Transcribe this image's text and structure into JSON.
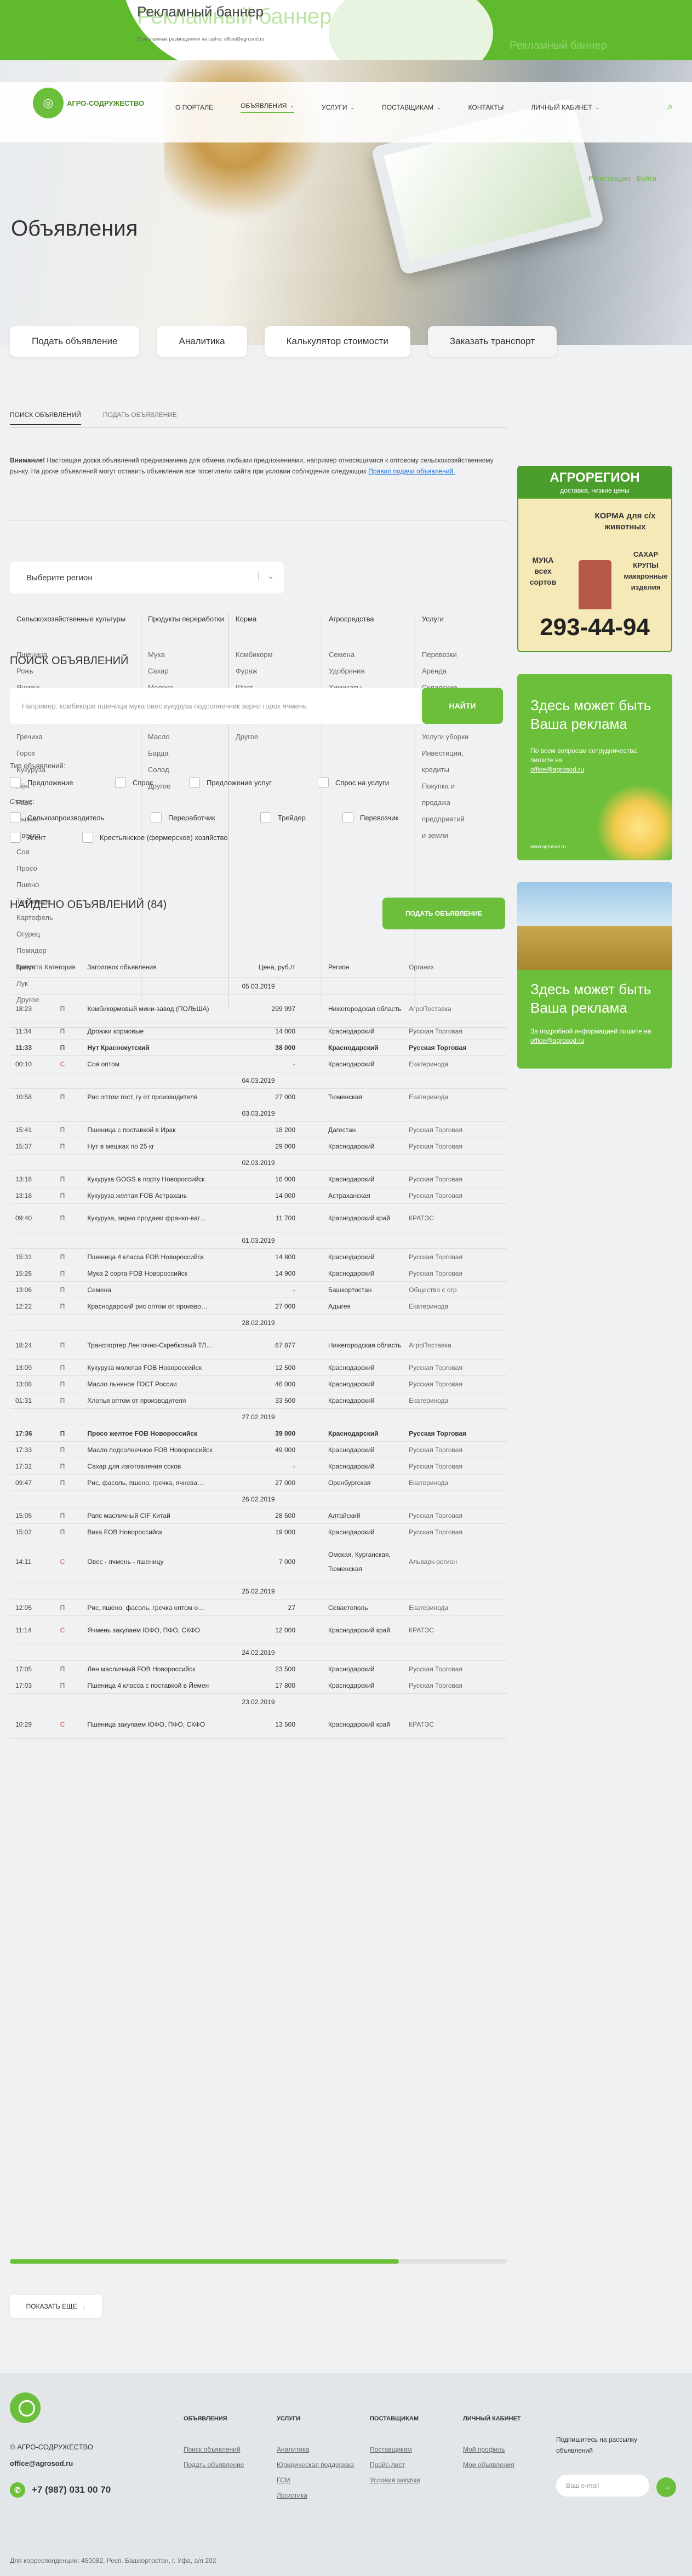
{
  "top_banner": {
    "ghost": "Рекламный баннер",
    "title": "Рекламный баннер",
    "note": "О рекламных размещениях на сайте: office@agrosod.ru",
    "ghost2": "Рекламный баннер"
  },
  "brand": {
    "logo_text": "АГРО-СОДРУЖЕСТВО"
  },
  "nav": [
    {
      "label": "О портале",
      "arrow": false,
      "active": false
    },
    {
      "label": "Объявления",
      "arrow": true,
      "active": true
    },
    {
      "label": "Услуги",
      "arrow": true,
      "active": false
    },
    {
      "label": "Поставщикам",
      "arrow": true,
      "active": false
    },
    {
      "label": "Контакты",
      "arrow": false,
      "active": false
    },
    {
      "label": "Личный кабинет",
      "arrow": true,
      "active": false
    }
  ],
  "auth": {
    "register": "Регистрация",
    "sep": " · ",
    "login": "Войти"
  },
  "page_title": "Объявления",
  "hero_tabs": [
    "Подать объявление",
    "Аналитика",
    "Калькулятор стоимости",
    "Заказать транспорт"
  ],
  "subtabs": [
    "Поиск объявлений",
    "Подать объявление"
  ],
  "notice": {
    "bold": "Внимание!",
    "text": " Настоящая доска объявлений предназначена для обмена любыми предложениями, например относящимися к оптовому сельскохозяйственному рынку. На доске объявлений могут оставить объявления все посетители сайта при условии соблюдения следующих ",
    "link": "Правил подачи объявлений."
  },
  "region": {
    "placeholder": "Выберите регион"
  },
  "categories": [
    {
      "title": "Сельскохозяйственные культуры",
      "items": [
        "Пшеница",
        "Рожь",
        "Ячмень",
        "Овес",
        "Подсолнечник",
        "Гречиха",
        "Горох",
        "Кукуруза",
        "Лён",
        "Рапс",
        "Рыжик",
        "Свекла",
        "Соя",
        "Просо",
        "Пшено",
        "Тритикале",
        "Картофель",
        "Огурец",
        "Помидор",
        "Капуста",
        "Лук",
        "Другое"
      ]
    },
    {
      "title": "Продукты переработки",
      "items": [
        "Мука",
        "Сахар",
        "Молоко",
        "Мясо",
        "Крупа",
        "Масло",
        "Барда",
        "Солод",
        "Другое"
      ]
    },
    {
      "title": "Корма",
      "items": [
        "Комбикорм",
        "Фураж",
        "Шрот",
        "Жмых",
        "Отруби",
        "Другое"
      ]
    },
    {
      "title": "Агросредства",
      "items": [
        "Семена",
        "Удобрения",
        "Химикаты"
      ]
    },
    {
      "title": "Услуги",
      "items": [
        "Перевозки",
        "Аренда",
        "Складские",
        "услуги и",
        "хранение",
        "Услуги уборки",
        "Инвестиции,",
        "кредиты",
        "Покупка и",
        "продажа",
        "предприятий",
        "и земли"
      ]
    }
  ],
  "search": {
    "heading": "Поиск объявлений",
    "placeholder": "Например: комбикорм пшеница мука овес кукуруза подсолнечник зерно горох ячмень",
    "button": "Найти"
  },
  "filters": {
    "type_label": "Тип объявлений:",
    "types": [
      "Предложение",
      "Спрос",
      "Предложение услуг",
      "Спрос на услуги"
    ],
    "status_label": "Статус:",
    "statuses": [
      "Сельхозпроизводитель",
      "Переработчик",
      "Трейдер",
      "Перевозчик",
      "Агент",
      "Крестьянское (фермерское) хозяйство"
    ]
  },
  "results": {
    "title": "Найдено объявлений (84)",
    "add_button": "Подать объявление"
  },
  "table": {
    "headers": [
      "Время",
      "Категория",
      "Заголовок объявления",
      "Цена, руб./т",
      "Регион",
      "Организ"
    ],
    "groups": [
      {
        "date": "05.03.2019",
        "rows": [
          {
            "t": "18:23",
            "c": "П",
            "title": "Комбикормовый мини-завод (ПОЛЬША)",
            "price": "299 997",
            "region": "Нижегородская область",
            "org": "АгроПоставка"
          },
          {
            "t": "11:34",
            "c": "П",
            "title": "Дрожжи кормовые",
            "price": "14 000",
            "region": "Краснодарский",
            "org": "Русская Торговая"
          },
          {
            "t": "11:33",
            "c": "П",
            "title": "Нут Краснокутский",
            "price": "38 000",
            "region": "Краснодарский",
            "org": "Русская Торговая",
            "bold": true
          },
          {
            "t": "00:10",
            "c": "С",
            "title": "Соя оптом",
            "price": "-",
            "region": "Краснодарский",
            "org": "Екатеринода"
          }
        ]
      },
      {
        "date": "04.03.2019",
        "rows": [
          {
            "t": "10:58",
            "c": "П",
            "title": "Рис оптом гост, гу от производителя",
            "price": "27 000",
            "region": "Тюменская",
            "org": "Екатеринода"
          }
        ]
      },
      {
        "date": "03.03.2019",
        "rows": [
          {
            "t": "15:41",
            "c": "П",
            "title": "Пшеница с поставкой в Ирак",
            "price": "18 200",
            "region": "Дагестан",
            "org": "Русская Торговая"
          },
          {
            "t": "15:37",
            "c": "П",
            "title": "Нут в мешках по 25 кг",
            "price": "29 000",
            "region": "Краснодарский",
            "org": "Русская Торговая"
          }
        ]
      },
      {
        "date": "02.03.2019",
        "rows": [
          {
            "t": "13:18",
            "c": "П",
            "title": "Кукуруза GOGS в порту Новороссийск",
            "price": "16 000",
            "region": "Краснодарский",
            "org": "Русская Торговая"
          },
          {
            "t": "13:18",
            "c": "П",
            "title": "Кукуруза желтая FOB Астрахань",
            "price": "14 000",
            "region": "Астраханская",
            "org": "Русская Торговая"
          },
          {
            "t": "09:40",
            "c": "П",
            "title": "Кукуруза, зерно продаем франко-ваг…",
            "price": "11 700",
            "region": "Краснодарский край",
            "org": "КРАТЭС"
          }
        ]
      },
      {
        "date": "01.03.2019",
        "rows": [
          {
            "t": "15:31",
            "c": "П",
            "title": "Пшеница 4 класса FOB Новороссийск",
            "price": "14 800",
            "region": "Краснодарский",
            "org": "Русская Торговая"
          },
          {
            "t": "15:26",
            "c": "П",
            "title": "Мука 2 сорта FOB Новороссийск",
            "price": "14 900",
            "region": "Краснодарский",
            "org": "Русская Торговая"
          },
          {
            "t": "13:06",
            "c": "П",
            "title": "Семена",
            "price": "-",
            "region": "Башкортостан",
            "org": "Общество с огр"
          },
          {
            "t": "12:22",
            "c": "П",
            "title": "Краснодарский рис оптом от произво…",
            "price": "27 000",
            "region": "Адыгея",
            "org": "Екатеринода"
          }
        ]
      },
      {
        "date": "28.02.2019",
        "rows": [
          {
            "t": "18:24",
            "c": "П",
            "title": "Транспортер Ленточно-Скребковый ТЛ…",
            "price": "67 877",
            "region": "Нижегородская область",
            "org": "АгроПоставка"
          },
          {
            "t": "13:09",
            "c": "П",
            "title": "Кукуруза молотая FOB Новороссийск",
            "price": "12 500",
            "region": "Краснодарский",
            "org": "Русская Торговая"
          },
          {
            "t": "13:08",
            "c": "П",
            "title": "Масло льняное ГОСТ России",
            "price": "46 000",
            "region": "Краснодарский",
            "org": "Русская Торговая"
          },
          {
            "t": "01:31",
            "c": "П",
            "title": "Хлопья оптом от производителя",
            "price": "33 500",
            "region": "Краснодарский",
            "org": "Екатеринода"
          }
        ]
      },
      {
        "date": "27.02.2019",
        "rows": [
          {
            "t": "17:36",
            "c": "П",
            "title": "Просо желтое FOB Новороссийск",
            "price": "39 000",
            "region": "Краснодарский",
            "org": "Русская Торговая",
            "bold": true
          },
          {
            "t": "17:33",
            "c": "П",
            "title": "Масло подсолнечное FOB Новороссийск",
            "price": "49 000",
            "region": "Краснодарский",
            "org": "Русская Торговая"
          },
          {
            "t": "17:32",
            "c": "П",
            "title": "Сахар для изготовления соков",
            "price": "-",
            "region": "Краснодарский",
            "org": "Русская Торговая"
          },
          {
            "t": "09:47",
            "c": "П",
            "title": "Рис, фасоль, пшено, гречка, ячнева…",
            "price": "27 000",
            "region": "Оренбургская",
            "org": "Екатеринода"
          }
        ]
      },
      {
        "date": "26.02.2019",
        "rows": [
          {
            "t": "15:05",
            "c": "П",
            "title": "Рапс масличный CIF Китай",
            "price": "28 500",
            "region": "Алтайский",
            "org": "Русская Торговая"
          },
          {
            "t": "15:02",
            "c": "П",
            "title": "Вика FOB Новороссийск",
            "price": "19 000",
            "region": "Краснодарский",
            "org": "Русская Торговая"
          },
          {
            "t": "14:11",
            "c": "С",
            "title": "Овес - ячмень - пшеницу",
            "price": "7 000",
            "region": "Омская, Курганская, Тюменская",
            "org": "Альварк-регион"
          }
        ]
      },
      {
        "date": "25.02.2019",
        "rows": [
          {
            "t": "12:05",
            "c": "П",
            "title": "Рис, пшено, фасоль, гречка оптом о…",
            "price": "27",
            "region": "Севастополь",
            "org": "Екатеринода"
          },
          {
            "t": "11:14",
            "c": "С",
            "title": "Ячмень закупаем ЮФО, ПФО, СКФО",
            "price": "12 000",
            "region": "Краснодарский край",
            "org": "КРАТЭС"
          }
        ]
      },
      {
        "date": "24.02.2019",
        "rows": [
          {
            "t": "17:05",
            "c": "П",
            "title": "Лен масличный FOB Новороссийск",
            "price": "23 500",
            "region": "Краснодарский",
            "org": "Русская Торговая"
          },
          {
            "t": "17:03",
            "c": "П",
            "title": "Пшеница 4 класса с поставкой в Йемен",
            "price": "17 800",
            "region": "Краснодарский",
            "org": "Русская Торговая"
          }
        ]
      },
      {
        "date": "23.02.2019",
        "rows": [
          {
            "t": "10:29",
            "c": "С",
            "title": "Пшеница закупаем ЮФО, ПФО, СКФО",
            "price": "13 500",
            "region": "Краснодарский край",
            "org": "КРАТЭС"
          }
        ]
      }
    ]
  },
  "show_more": "Показать еще",
  "ads": {
    "agro": {
      "title": "АГРОРЕГИОН",
      "sub": "доставка, низкие цены",
      "l1": "КОРМА для с/х животных",
      "l2": "МУКА всех сортов",
      "l3": "САХАР КРУПЫ макаронные изделия",
      "phone": "293-44-94"
    },
    "ad2": {
      "big": "Здесь может быть Ваша реклама",
      "sm": "По всем вопросам сотрудничества пишите на",
      "email": "office@agrosod.ru",
      "site": "www.agrosod.ru"
    },
    "ad3": {
      "big": "Здесь может быть Ваша реклама",
      "sm": "За подробной информацией пишите на",
      "email": "office@agrosod.ru"
    }
  },
  "footer": {
    "brand": "© АГРО-СОДРУЖЕСТВО",
    "email": "office@agrosod.ru",
    "phone": "+7 (987) 031 00 70",
    "address": "Для корреспонденции: 450082, Респ. Башкортостан, г. Уфа, а/я 202",
    "cols": [
      {
        "h": "Объявления",
        "links": [
          "Поиск объявлений",
          "Подать объявление"
        ]
      },
      {
        "h": "Услуги",
        "links": [
          "Аналитика",
          "Юридическая поддержка",
          "ГСМ",
          "Логистика"
        ]
      },
      {
        "h": "Поставщикам",
        "links": [
          "Поставщикам",
          "Прайс-лист",
          "Условия закупки"
        ]
      },
      {
        "h": "Личный кабинет",
        "links": [
          "Мой профиль",
          "Мои объявления"
        ]
      }
    ],
    "subscribe_title": "Подпишитесь на рассылку объявлений",
    "subscribe_placeholder": "Ваш e-mail"
  }
}
